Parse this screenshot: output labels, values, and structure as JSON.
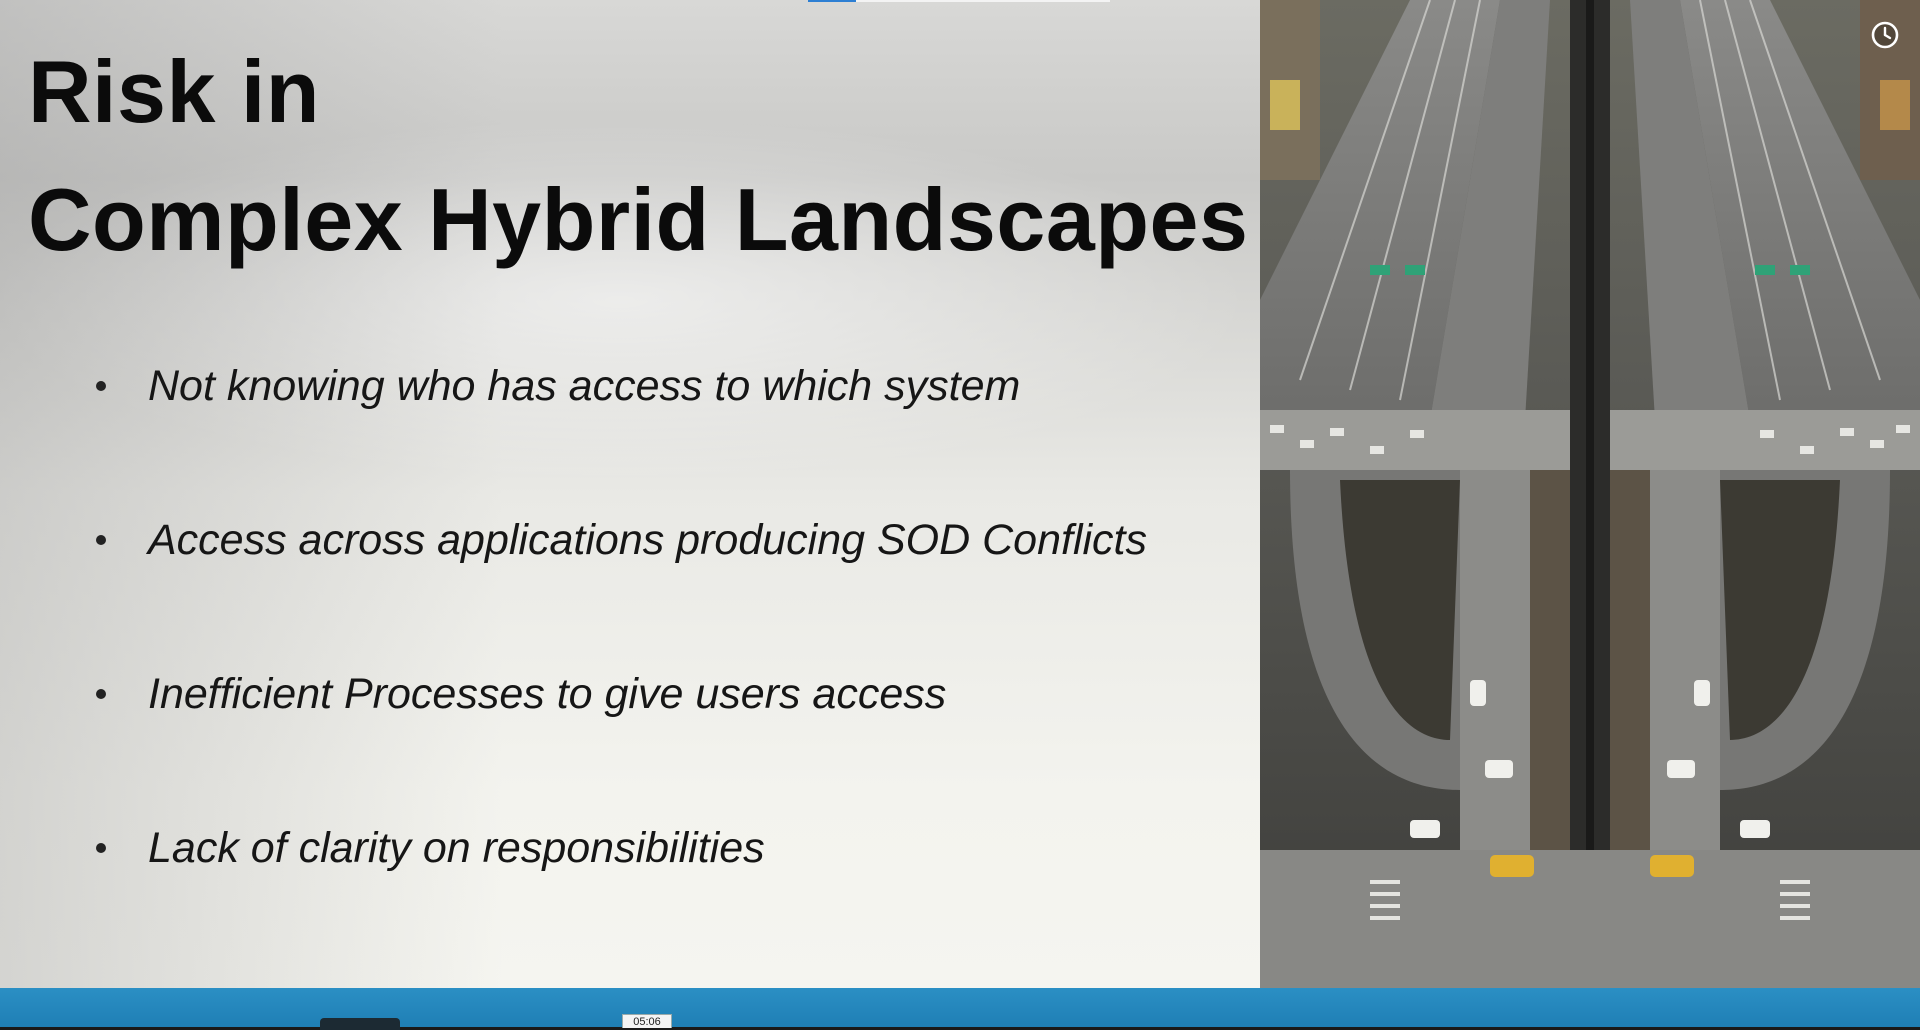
{
  "slide": {
    "title_line1": "Risk in",
    "title_line2": "Complex Hybrid Landscapes",
    "bullets": [
      "Not knowing who has access to which system",
      "Access across applications producing SOD Conflicts",
      "Inefficient Processes to give users access",
      "Lack of clarity on responsibilities"
    ],
    "image": "aerial-highway-interchange-photo"
  },
  "player": {
    "progress": 0.16,
    "timestamp_tooltip": "05:06",
    "clock_icon": "clock-icon",
    "accent_color": "#1f7fb5"
  }
}
